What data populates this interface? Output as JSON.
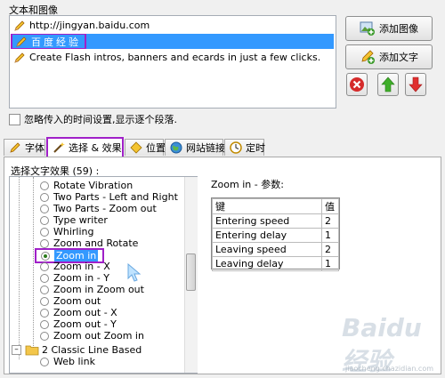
{
  "section_title": "文本和图像",
  "text_list": [
    {
      "text": "http://jingyan.baidu.com",
      "selected": false
    },
    {
      "text": "百度经验",
      "selected": true
    },
    {
      "text": "Create Flash intros, banners and ecards in just a few clicks.",
      "selected": false
    }
  ],
  "buttons": {
    "add_image": "添加图像",
    "add_text": "添加文字"
  },
  "ignore_time_label": "忽略传入的时间设置,显示逐个段落.",
  "tabs": [
    "字体",
    "选择 & 效果",
    "位置",
    "网站链接",
    "定时"
  ],
  "effects_header": "选择文字效果 (59) :",
  "effects": [
    "Rotate Vibration",
    "Two Parts - Left and Right",
    "Two Parts - Zoom out",
    "Type writer",
    "Whirling",
    "Zoom and Rotate",
    "Zoom in",
    "Zoom in - X",
    "Zoom in - Y",
    "Zoom in Zoom out",
    "Zoom out",
    "Zoom out - X",
    "Zoom out - Y",
    "Zoom out Zoom in"
  ],
  "selected_effect": "Zoom in",
  "folder": "2 Classic Line Based",
  "folder_child": "Web link",
  "params_title": "Zoom in - 参数:",
  "params_headers": [
    "键",
    "值"
  ],
  "params": [
    [
      "Entering speed",
      "2"
    ],
    [
      "Entering delay",
      "1"
    ],
    [
      "Leaving speed",
      "2"
    ],
    [
      "Leaving delay",
      "1"
    ]
  ],
  "watermark": "Baidu经验",
  "watermark_url": "jiaocheng.chazidian.com",
  "colors": {
    "selection": "#3399ff",
    "highlight": "#a020c8"
  }
}
